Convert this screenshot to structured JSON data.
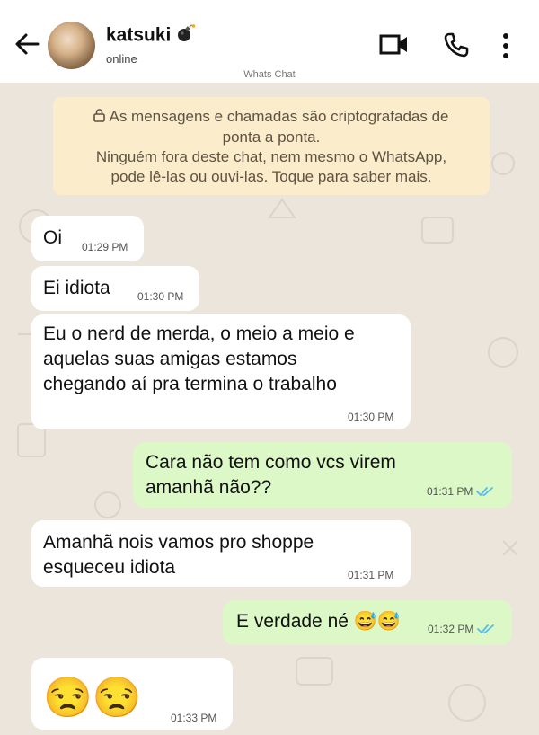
{
  "header": {
    "contact_name": "katsuki",
    "status": "online",
    "watermark": "Whats Chat",
    "icons": [
      "back-arrow-icon",
      "bomb-emoji-icon",
      "video-call-icon",
      "voice-call-icon",
      "more-options-icon"
    ]
  },
  "encryption_notice": {
    "line1": "As mensagens e chamadas são criptografadas de",
    "line2": "ponta a ponta.",
    "line3": "Ninguém fora deste chat, nem mesmo o WhatsApp,",
    "line4": "pode lê-las ou ouvi-las. Toque para saber mais.",
    "icon": "lock-icon"
  },
  "messages": [
    {
      "direction": "incoming",
      "lines": [
        "Oi"
      ],
      "time": "01:29 PM"
    },
    {
      "direction": "incoming",
      "lines": [
        "Ei idiota"
      ],
      "time": "01:30 PM"
    },
    {
      "direction": "incoming",
      "lines": [
        "Eu o nerd de merda, o meio a meio e",
        "aquelas suas amigas estamos",
        "chegando aí pra termina o trabalho"
      ],
      "time": "01:30 PM"
    },
    {
      "direction": "outgoing",
      "lines": [
        "Cara não tem como vcs virem",
        "amanhã não??"
      ],
      "time": "01:31 PM",
      "read": true
    },
    {
      "direction": "incoming",
      "lines": [
        "Amanhã nois vamos pro shoppe",
        "esqueceu idiota"
      ],
      "time": "01:31 PM"
    },
    {
      "direction": "outgoing",
      "lines": [
        "E verdade né 😅😅"
      ],
      "time": "01:32 PM",
      "read": true
    },
    {
      "direction": "incoming",
      "lines": [
        "😒😒"
      ],
      "time": "01:33 PM"
    }
  ],
  "colors": {
    "chat_background": "#ece5dc",
    "incoming_bubble": "#ffffff",
    "outgoing_bubble": "#dbf8c6",
    "notice_background": "#fbeccb",
    "read_ticks": "#53bdeb"
  }
}
